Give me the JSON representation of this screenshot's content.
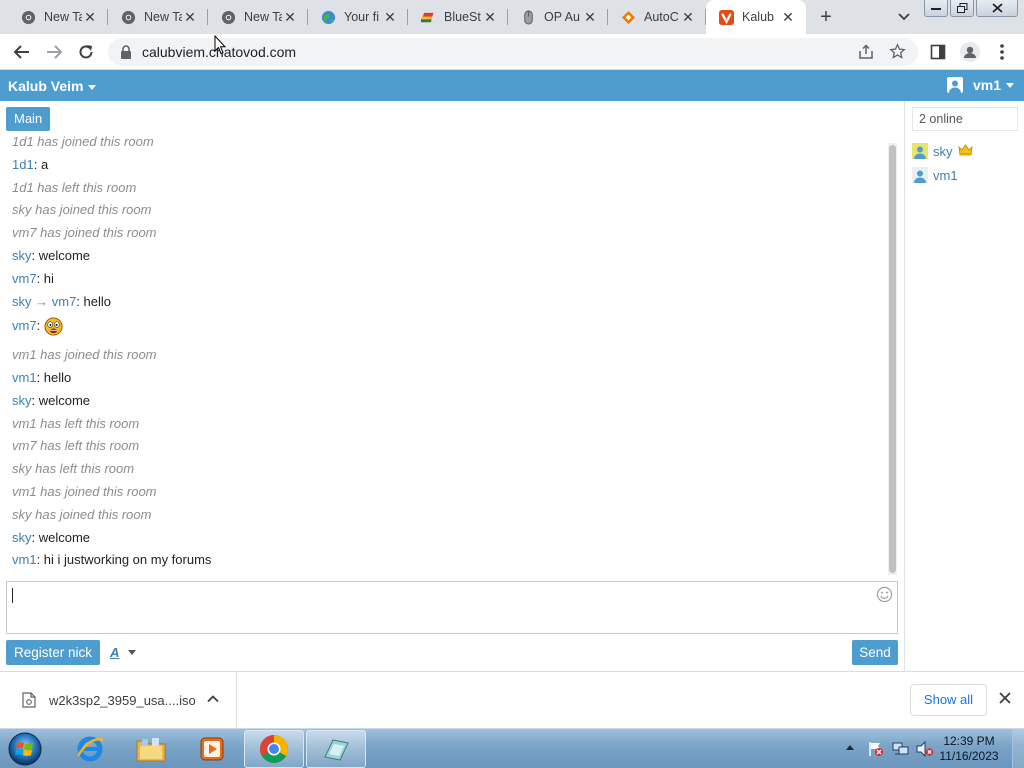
{
  "browser": {
    "tabs": [
      {
        "title": "New Ta",
        "icon": "chrome-icon"
      },
      {
        "title": "New Ta",
        "icon": "chrome-icon"
      },
      {
        "title": "New Ta",
        "icon": "chrome-icon"
      },
      {
        "title": "Your fi",
        "icon": "globe-icon"
      },
      {
        "title": "BlueSt",
        "icon": "bluestacks-icon"
      },
      {
        "title": "OP Au",
        "icon": "mouse-icon"
      },
      {
        "title": "AutoC",
        "icon": "autoclicker-icon"
      },
      {
        "title": "Kalub",
        "icon": "vivaldi-icon",
        "active": true
      }
    ],
    "url": "calubviem.chatovod.com"
  },
  "chat": {
    "room_title": "Kalub Veim",
    "current_user": "vm1",
    "room_tab": "Main",
    "messages": [
      {
        "type": "system",
        "text": "1d1 has joined this room"
      },
      {
        "type": "message",
        "nick": "1d1",
        "sep": ": ",
        "text": "a"
      },
      {
        "type": "system",
        "text": "1d1 has left this room"
      },
      {
        "type": "system",
        "text": "sky has joined this room"
      },
      {
        "type": "system",
        "text": "vm7 has joined this room"
      },
      {
        "type": "message",
        "nick": "sky",
        "sep": ": ",
        "text": "welcome"
      },
      {
        "type": "message",
        "nick": "vm7",
        "sep": ": ",
        "text": "hi"
      },
      {
        "type": "private",
        "nick": "sky",
        "arrow": " → ",
        "to": "vm7",
        "sep": ": ",
        "text": "hello"
      },
      {
        "type": "emoji",
        "nick": "vm7",
        "sep": ": ",
        "emoji": "surprised-smiley-icon"
      },
      {
        "type": "system",
        "text": "vm1 has joined this room"
      },
      {
        "type": "message",
        "nick": "vm1",
        "sep": ": ",
        "text": "hello"
      },
      {
        "type": "message",
        "nick": "sky",
        "sep": ": ",
        "text": "welcome"
      },
      {
        "type": "system",
        "text": "vm1 has left this room"
      },
      {
        "type": "system",
        "text": "vm7 has left this room"
      },
      {
        "type": "system",
        "text": "sky has left this room"
      },
      {
        "type": "system",
        "text": "vm1 has joined this room"
      },
      {
        "type": "system",
        "text": "sky has joined this room"
      },
      {
        "type": "message",
        "nick": "sky",
        "sep": ": ",
        "text": "welcome"
      },
      {
        "type": "message",
        "nick": "vm1",
        "sep": ": ",
        "text": "hi i justworking on my forums"
      }
    ],
    "online_count": "2 online",
    "users": [
      {
        "name": "sky",
        "badge": "crown-icon"
      },
      {
        "name": "vm1"
      }
    ],
    "composer": {
      "value": "",
      "placeholder": ""
    },
    "register_label": "Register nick",
    "font_label": "A",
    "send_label": "Send"
  },
  "downloads": {
    "file_name": "w2k3sp2_3959_usa....iso",
    "show_all_label": "Show all"
  },
  "taskbar": {
    "time": "12:39 PM",
    "date": "11/16/2023"
  },
  "colors": {
    "accent": "#4d9dcf",
    "nick": "#3a80b4",
    "system_text": "#8c8c8c"
  }
}
